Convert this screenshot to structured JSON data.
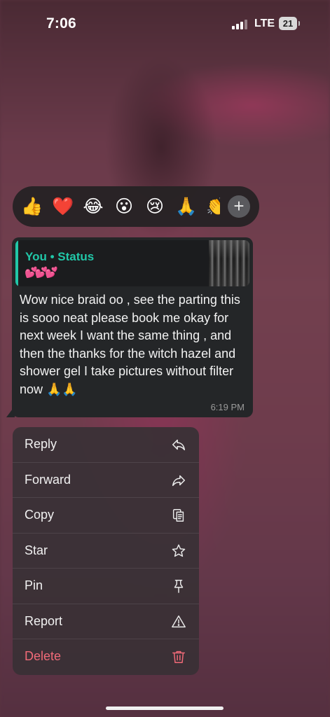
{
  "status_bar": {
    "time": "7:06",
    "network": "LTE",
    "battery": "21"
  },
  "reactions": {
    "emojis": [
      "👍",
      "❤️",
      "😂",
      "😮",
      "😢",
      "🙏",
      "👏"
    ],
    "more": "+"
  },
  "message": {
    "quote_author": "You • Status",
    "quote_caption": "💕💕💕",
    "text": "Wow nice braid oo , see the parting this is sooo neat please book me okay for next week I want the same thing , and then the thanks for the witch hazel and shower gel I take pictures without filter now 🙏🙏",
    "time": "6:19 PM"
  },
  "menu": {
    "items": [
      {
        "label": "Reply",
        "icon": "reply-icon"
      },
      {
        "label": "Forward",
        "icon": "forward-icon"
      },
      {
        "label": "Copy",
        "icon": "copy-icon"
      },
      {
        "label": "Star",
        "icon": "star-icon"
      },
      {
        "label": "Pin",
        "icon": "pin-icon"
      },
      {
        "label": "Report",
        "icon": "report-icon"
      },
      {
        "label": "Delete",
        "icon": "trash-icon"
      }
    ]
  },
  "colors": {
    "accent": "#21c7a8",
    "danger": "#f16a78",
    "bubble": "#242628"
  }
}
